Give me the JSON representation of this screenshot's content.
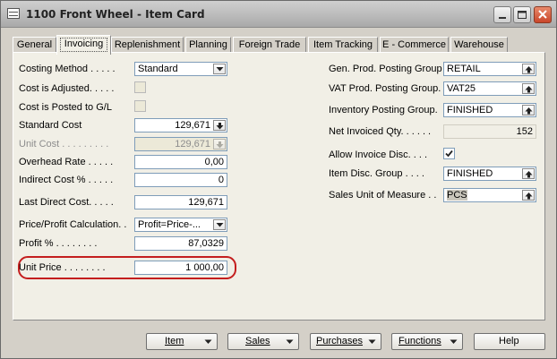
{
  "window": {
    "title": "1100 Front Wheel - Item Card",
    "icon": "item-card-icon"
  },
  "tabs": [
    {
      "label": "General",
      "active": false
    },
    {
      "label": "Invoicing",
      "active": true
    },
    {
      "label": "Replenishment",
      "active": false
    },
    {
      "label": "Planning",
      "active": false
    },
    {
      "label": "Foreign Trade",
      "active": false
    },
    {
      "label": "Item Tracking",
      "active": false
    },
    {
      "label": "E - Commerce",
      "active": false
    },
    {
      "label": "Warehouse",
      "active": false
    }
  ],
  "left": {
    "costing_method": {
      "label": "Costing Method . . . . .",
      "value": "Standard"
    },
    "cost_is_adjusted": {
      "label": "Cost is Adjusted. . . . .",
      "checked": false
    },
    "cost_posted_gl": {
      "label": "Cost is Posted to G/L",
      "checked": false
    },
    "standard_cost": {
      "label": "Standard Cost",
      "value": "129,671"
    },
    "unit_cost": {
      "label": "Unit Cost . . . . . . . . .",
      "value": "129,671"
    },
    "overhead_rate": {
      "label": "Overhead Rate . . . . .",
      "value": "0,00"
    },
    "indirect_cost": {
      "label": "Indirect Cost % . . . . .",
      "value": "0"
    },
    "last_direct_cost": {
      "label": "Last Direct Cost. . . . .",
      "value": "129,671"
    },
    "price_profit_calc": {
      "label": "Price/Profit Calculation. .",
      "value": "Profit=Price-..."
    },
    "profit_pct": {
      "label": "Profit % . . . . . . . .",
      "value": "87,0329"
    },
    "unit_price": {
      "label": "Unit Price . . . . . . . .",
      "value": "1 000,00"
    }
  },
  "right": {
    "gen_prod_posting_group": {
      "label": "Gen. Prod. Posting Group",
      "value": "RETAIL"
    },
    "vat_prod_posting_group": {
      "label": "VAT Prod. Posting Group.",
      "value": "VAT25"
    },
    "inventory_posting_group": {
      "label": "Inventory Posting Group.",
      "value": "FINISHED"
    },
    "net_invoiced_qty": {
      "label": "Net Invoiced Qty. . . . . .",
      "value": "152"
    },
    "allow_invoice_disc": {
      "label": "Allow Invoice Disc. . . .",
      "checked": true
    },
    "item_disc_group": {
      "label": "Item Disc. Group . . . .",
      "value": "FINISHED"
    },
    "sales_unit_of_measure": {
      "label": "Sales Unit of Measure . .",
      "value": "PCS"
    }
  },
  "buttons": {
    "item": "Item",
    "sales": "Sales",
    "purchases": "Purchases",
    "functions": "Functions",
    "help": "Help"
  },
  "colors": {
    "highlight": "#c41e1e",
    "panel": "#f1efe6",
    "field_border": "#7f9db9"
  }
}
